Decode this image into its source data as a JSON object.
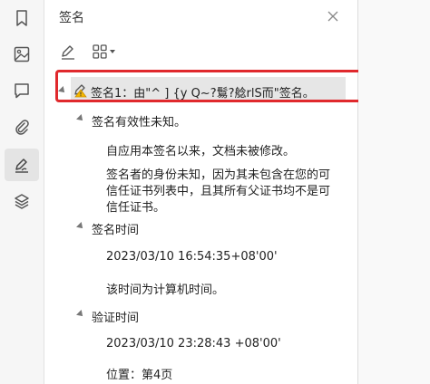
{
  "panel": {
    "title": "签名"
  },
  "signature": {
    "label": "签名1：由\"^ ]    {y Q~?鬄?艌rlS而\"签名。",
    "validity_heading": "签名有效性未知。",
    "doc_unmodified": "自应用本签名以来，文档未被修改。",
    "identity_unknown_line1": "签名者的身份未知，因为其未包含在您的可",
    "identity_unknown_line2": "信任证书列表中，且其所有父证书均不是可",
    "identity_unknown_line3": "信任证书。",
    "time_heading": "签名时间",
    "sign_time": "2023/03/10 16:54:35+08'00'",
    "time_source": "该时间为计算机时间。",
    "verify_heading": "验证时间",
    "verify_time": "2023/03/10 23:28:43 +08'00'",
    "location": "位置：第4页"
  }
}
